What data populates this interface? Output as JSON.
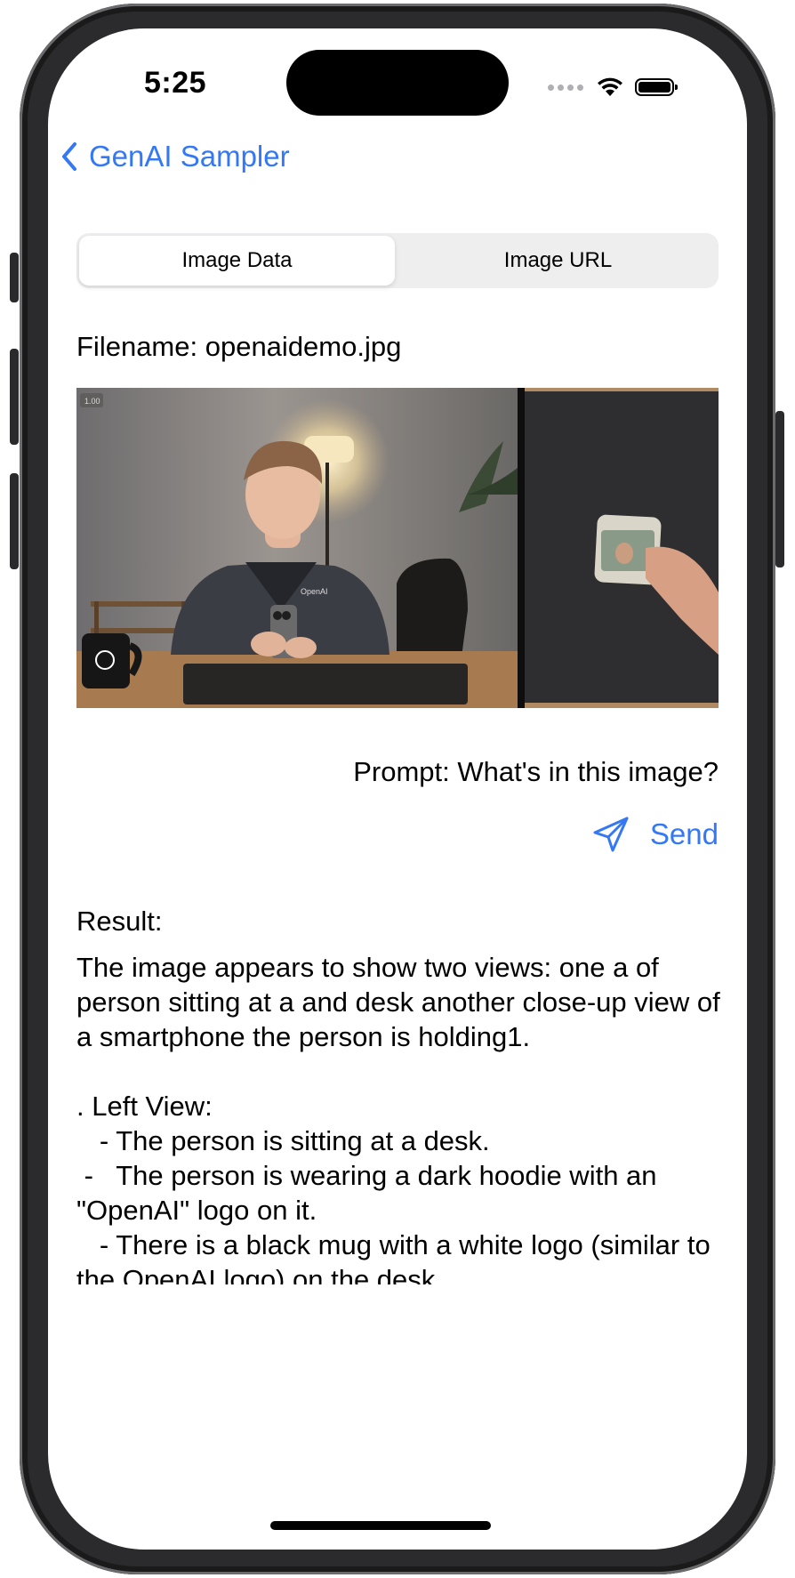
{
  "status_bar": {
    "time": "5:25",
    "icons": [
      "signal-dots-icon",
      "wifi-icon",
      "battery-icon"
    ]
  },
  "nav": {
    "back_label": "GenAI Sampler",
    "back_icon": "chevron-left-icon"
  },
  "segmented_control": {
    "options": [
      "Image Data",
      "Image URL"
    ],
    "selected": "Image Data"
  },
  "filename_text": "Filename: openaidemo.jpg",
  "image": {
    "description_icon": "photo-preview",
    "overlay_text": "1.00"
  },
  "prompt_text": "Prompt: What's in this image?",
  "send": {
    "label": "Send",
    "icon": "paper-plane-icon"
  },
  "result": {
    "label": "Result:",
    "text": "The image appears to show two views: one a of person sitting at a and desk another close-up view of a smartphone the person is holding1.\n\n. Left View:\n   - The person is sitting at a desk.\n -   The person is wearing a dark hoodie with an \"OpenAI\" logo on it.\n   - There is a black mug with a white logo (similar to the OpenAI logo) on the desk."
  },
  "colors": {
    "accent": "#3478f6",
    "segment_bg": "#eeeeef",
    "text": "#000000"
  }
}
